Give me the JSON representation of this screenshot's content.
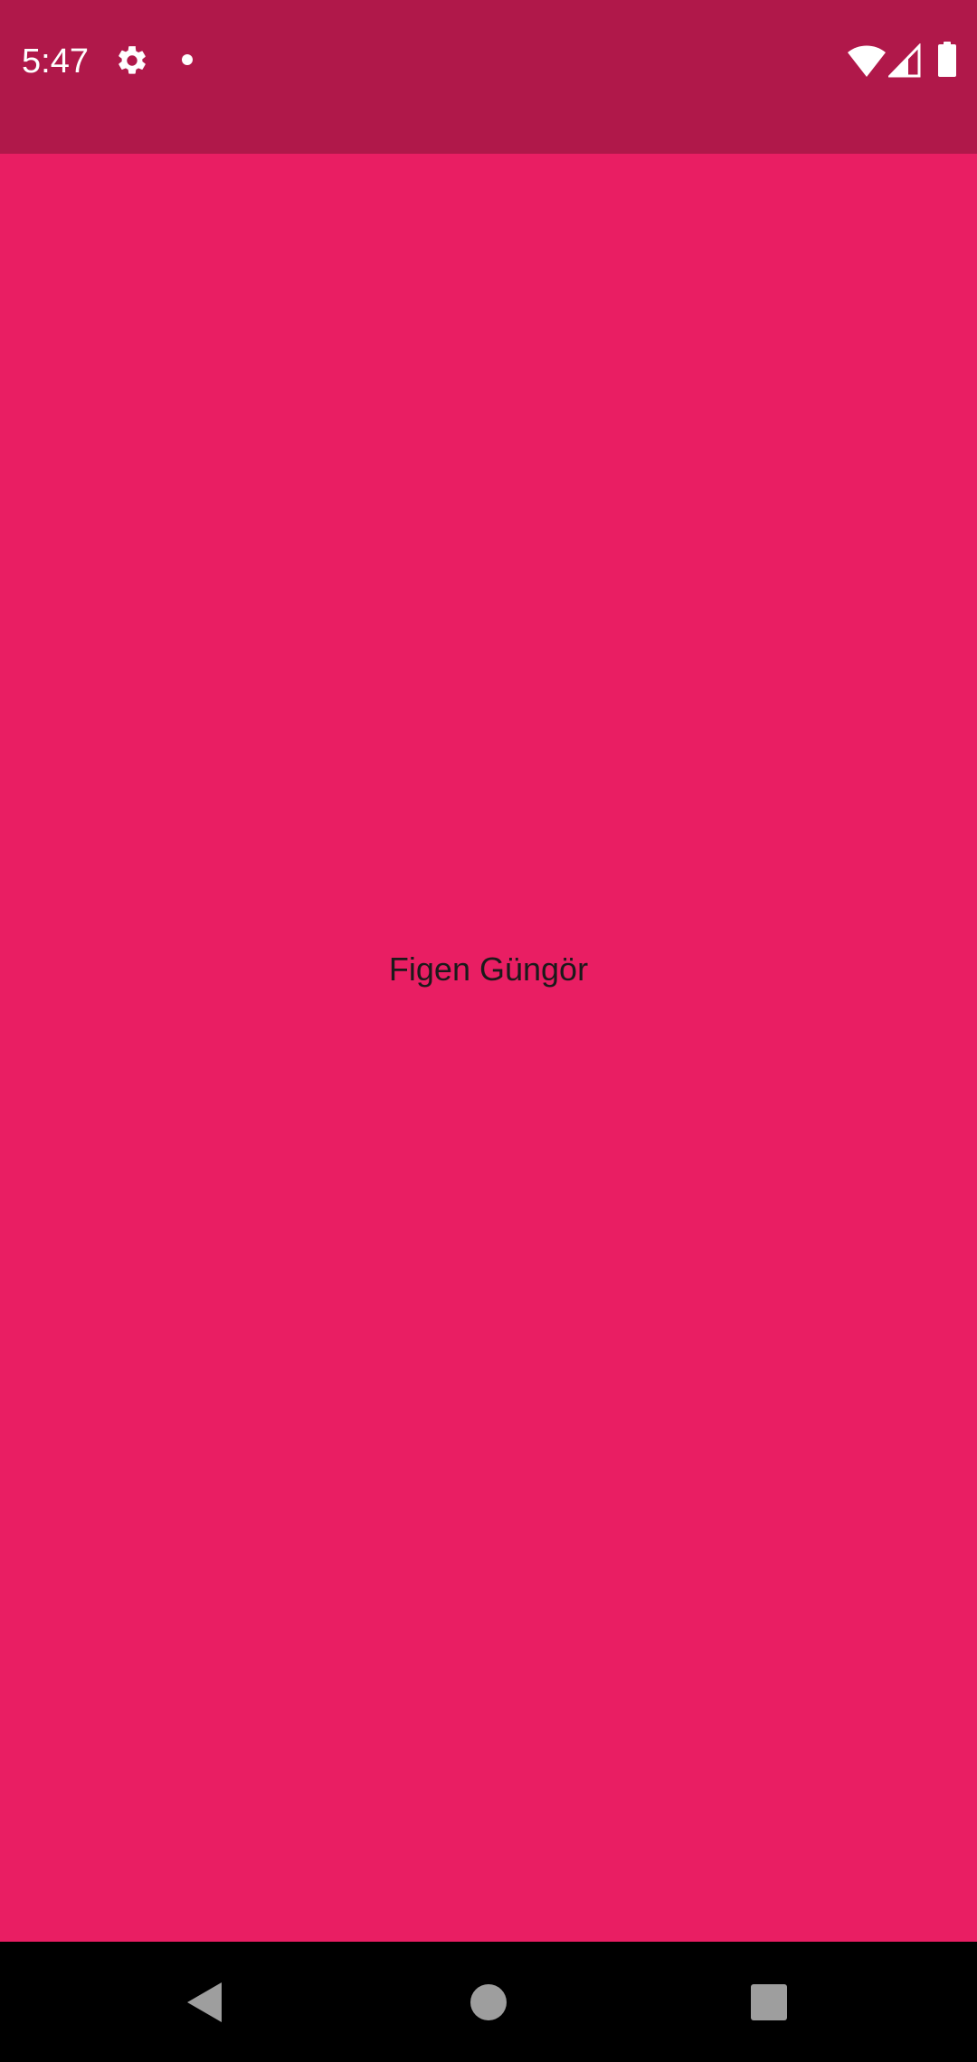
{
  "status_bar": {
    "time": "5:47",
    "icons": [
      "settings-gear-icon",
      "notification-dot-icon",
      "wifi-icon",
      "cell-signal-icon",
      "battery-icon"
    ],
    "background": "#B0184A"
  },
  "main": {
    "text": "Figen Güngör",
    "background": "#E91E63"
  },
  "nav_bar": {
    "icons": [
      "back-icon",
      "home-icon",
      "recents-icon"
    ],
    "background": "#000000"
  }
}
